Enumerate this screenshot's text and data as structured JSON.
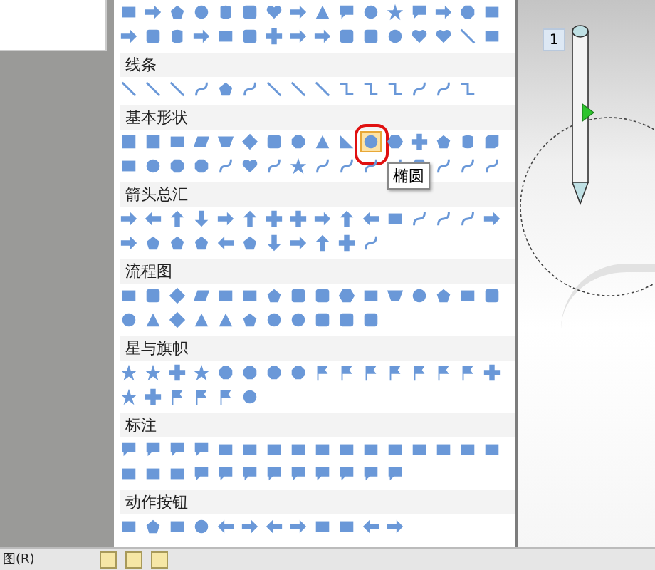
{
  "shape_menu": {
    "sections": [
      {
        "title": "线条"
      },
      {
        "title": "基本形状",
        "shapes": [
          {
            "kind": "textbox",
            "selected": false
          },
          {
            "kind": "vtextbox",
            "selected": false
          },
          {
            "kind": "rect",
            "selected": false
          },
          {
            "kind": "para",
            "selected": false
          },
          {
            "kind": "trap",
            "selected": false
          },
          {
            "kind": "diamond",
            "selected": false
          },
          {
            "kind": "rrect",
            "selected": false
          },
          {
            "kind": "oct",
            "selected": false
          },
          {
            "kind": "tri",
            "selected": false
          },
          {
            "kind": "rtri",
            "selected": false
          },
          {
            "kind": "circle",
            "selected": true
          },
          {
            "kind": "hex",
            "selected": false
          },
          {
            "kind": "plus",
            "selected": false
          },
          {
            "kind": "pent",
            "selected": false
          },
          {
            "kind": "can",
            "selected": false
          },
          {
            "kind": "cube",
            "selected": false
          }
        ]
      },
      {
        "title": "箭头总汇"
      },
      {
        "title": "流程图"
      },
      {
        "title": "星与旗帜"
      },
      {
        "title": "标注"
      },
      {
        "title": "动作按钮"
      }
    ]
  },
  "tooltip": {
    "text": "椭圆"
  },
  "slide": {
    "badge": "1"
  },
  "toolbar": {
    "label": "图(R)"
  }
}
